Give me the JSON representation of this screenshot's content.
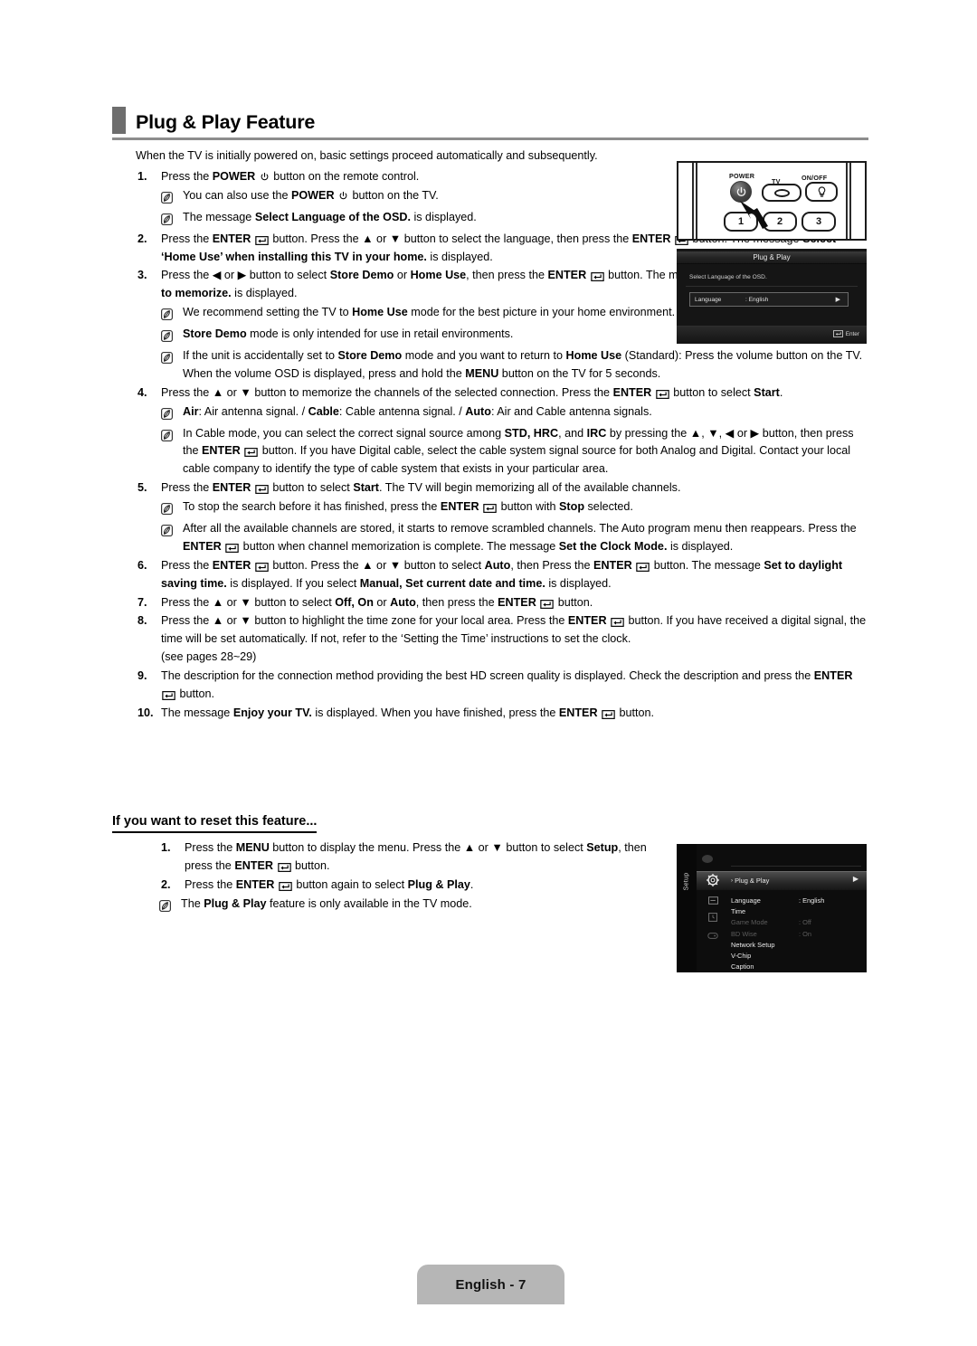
{
  "header": {
    "title": "Plug & Play Feature"
  },
  "intro": "When the TV is initially powered on, basic settings proceed automatically and subsequently.",
  "steps": [
    {
      "num": "1.",
      "html": "Press the <b>POWER</b> [power-icon] button on the remote control."
    },
    {
      "num": "2.",
      "html": "Press the <b>ENTER</b> [enter-icon] button. Press the ▲ or ▼ button to select the language, then press the <b>ENTER</b> [enter-icon] button. The message <b>Select ‘Home Use’ when installing this TV in your home.</b> is displayed."
    },
    {
      "num": "3.",
      "html": "Press the ◀ or ▶ button to select <b>Store Demo</b> or <b>Home Use</b>, then press the <b>ENTER</b> [enter-icon] button. The message <b>Select the Antenna source to memorize.</b> is displayed."
    },
    {
      "num": "4.",
      "html": "Press the ▲ or ▼ button to memorize the channels of the selected connection. Press the <b>ENTER</b> [enter-icon] button to select <b>Start</b>."
    },
    {
      "num": "5.",
      "html": "Press the <b>ENTER</b> [enter-icon] button to select <b>Start</b>. The TV will begin memorizing all of the available channels."
    },
    {
      "num": "6.",
      "html": "Press the <b>ENTER</b> [enter-icon] button. Press the ▲ or ▼ button to select <b>Auto</b>, then Press the <b>ENTER</b> [enter-icon] button. The message <b>Set to daylight saving time.</b> is displayed. If you select <b>Manual, Set current date and time.</b> is displayed."
    },
    {
      "num": "7.",
      "html": "Press the ▲ or ▼ button to select <b>Off, On</b> or <b>Auto</b>, then press the <b>ENTER</b> [enter-icon] button."
    },
    {
      "num": "8.",
      "html": "Press the ▲ or ▼ button to highlight the time zone for your local area. Press the <b>ENTER</b> [enter-icon] button. If you have received a digital signal, the time will be set automatically. If not, refer to the ‘Setting the Time’ instructions to set the clock.<br>(see pages 28~29)"
    },
    {
      "num": "9.",
      "html": "The description for the connection method providing the best HD screen quality is displayed. Check the description and press the <b>ENTER</b> [enter-icon] button."
    },
    {
      "num": "10.",
      "html": "The message <b>Enjoy your TV.</b> is displayed. When you have finished, press the <b>ENTER</b> [enter-icon] button."
    }
  ],
  "notes": {
    "after_step1": [
      "You can also use the <b>POWER</b> [power-icon] button on the TV.",
      "The message <b>Select Language of the OSD.</b> is displayed."
    ],
    "after_step3": [
      "We recommend setting the TV to <b>Home Use</b> mode for the best picture in your home environment.",
      "<b>Store Demo</b> mode is only intended for use in retail environments.",
      "If the unit is accidentally set to <b>Store Demo</b> mode and you want to return to <b>Home Use</b> (Standard): Press the volume button on the TV. When the volume OSD is displayed, press and hold the <b>MENU</b> button on the TV for 5 seconds."
    ],
    "after_step4": [
      "<b>Air</b>: Air antenna signal. / <b>Cable</b>: Cable antenna signal. / <b>Auto</b>: Air and Cable antenna signals.",
      "In Cable mode, you can select the correct signal source among <b>STD, HRC</b>, and <b>IRC</b> by pressing the ▲, ▼, ◀ or ▶ button, then press the <b>ENTER</b> [enter-icon] button. If you have Digital cable, select the cable system signal source for both Analog and Digital. Contact your local cable company to identify the type of cable system that exists in your particular area."
    ],
    "after_step5": [
      "To stop the search before it has finished, press the <b>ENTER</b> [enter-icon] button with <b>Stop</b> selected.",
      "After all the available channels are stored, it starts to remove scrambled channels. The Auto program menu then reappears. Press the <b>ENTER</b> [enter-icon] button when channel memorization is complete. The message <b>Set the Clock Mode.</b> is displayed."
    ]
  },
  "reset_section": {
    "heading": "If you want to reset this feature...",
    "steps": [
      {
        "num": "1.",
        "html": "Press the <b>MENU</b> button to display the menu. Press the ▲ or ▼ button to select <b>Setup</b>, then press the <b>ENTER</b> [enter-icon] button."
      },
      {
        "num": "2.",
        "html": "Press the <b>ENTER</b> [enter-icon] button again to select <b>Plug &amp; Play</b>."
      }
    ],
    "note": "The <b>Plug &amp; Play</b> feature is only available in the TV mode."
  },
  "figure_remote": {
    "labels": {
      "power": "POWER",
      "tv": "TV",
      "onoff": "ON/OFF"
    },
    "number_keys": [
      "1",
      "2",
      "3"
    ]
  },
  "figure_osd": {
    "title": "Plug & Play",
    "message": "Select Language of the OSD.",
    "row_key": "Language",
    "row_value": ": English",
    "row_arrow": "▶",
    "footer_label": "Enter"
  },
  "figure_menu": {
    "sidebar_label": "Setup",
    "selected_item": "Plug & Play",
    "selected_arrow": "▶",
    "items": [
      {
        "label": "Language",
        "value": ": English",
        "dim": false
      },
      {
        "label": "Time",
        "value": "",
        "dim": false
      },
      {
        "label": "Game Mode",
        "value": ": Off",
        "dim": true
      },
      {
        "label": "BD Wise",
        "value": ": On",
        "dim": true
      },
      {
        "label": "Network Setup",
        "value": "",
        "dim": false
      },
      {
        "label": "V-Chip",
        "value": "",
        "dim": false
      },
      {
        "label": "Caption",
        "value": "",
        "dim": false
      }
    ]
  },
  "footer": {
    "label": "English - 7"
  },
  "colors": {
    "header_bar": "#6e6e6e",
    "header_rule": "#8d8d8d",
    "footer_badge": "#b6b6b6",
    "osd_bg": "#151515",
    "menu_bg": "#0d0d0d"
  }
}
